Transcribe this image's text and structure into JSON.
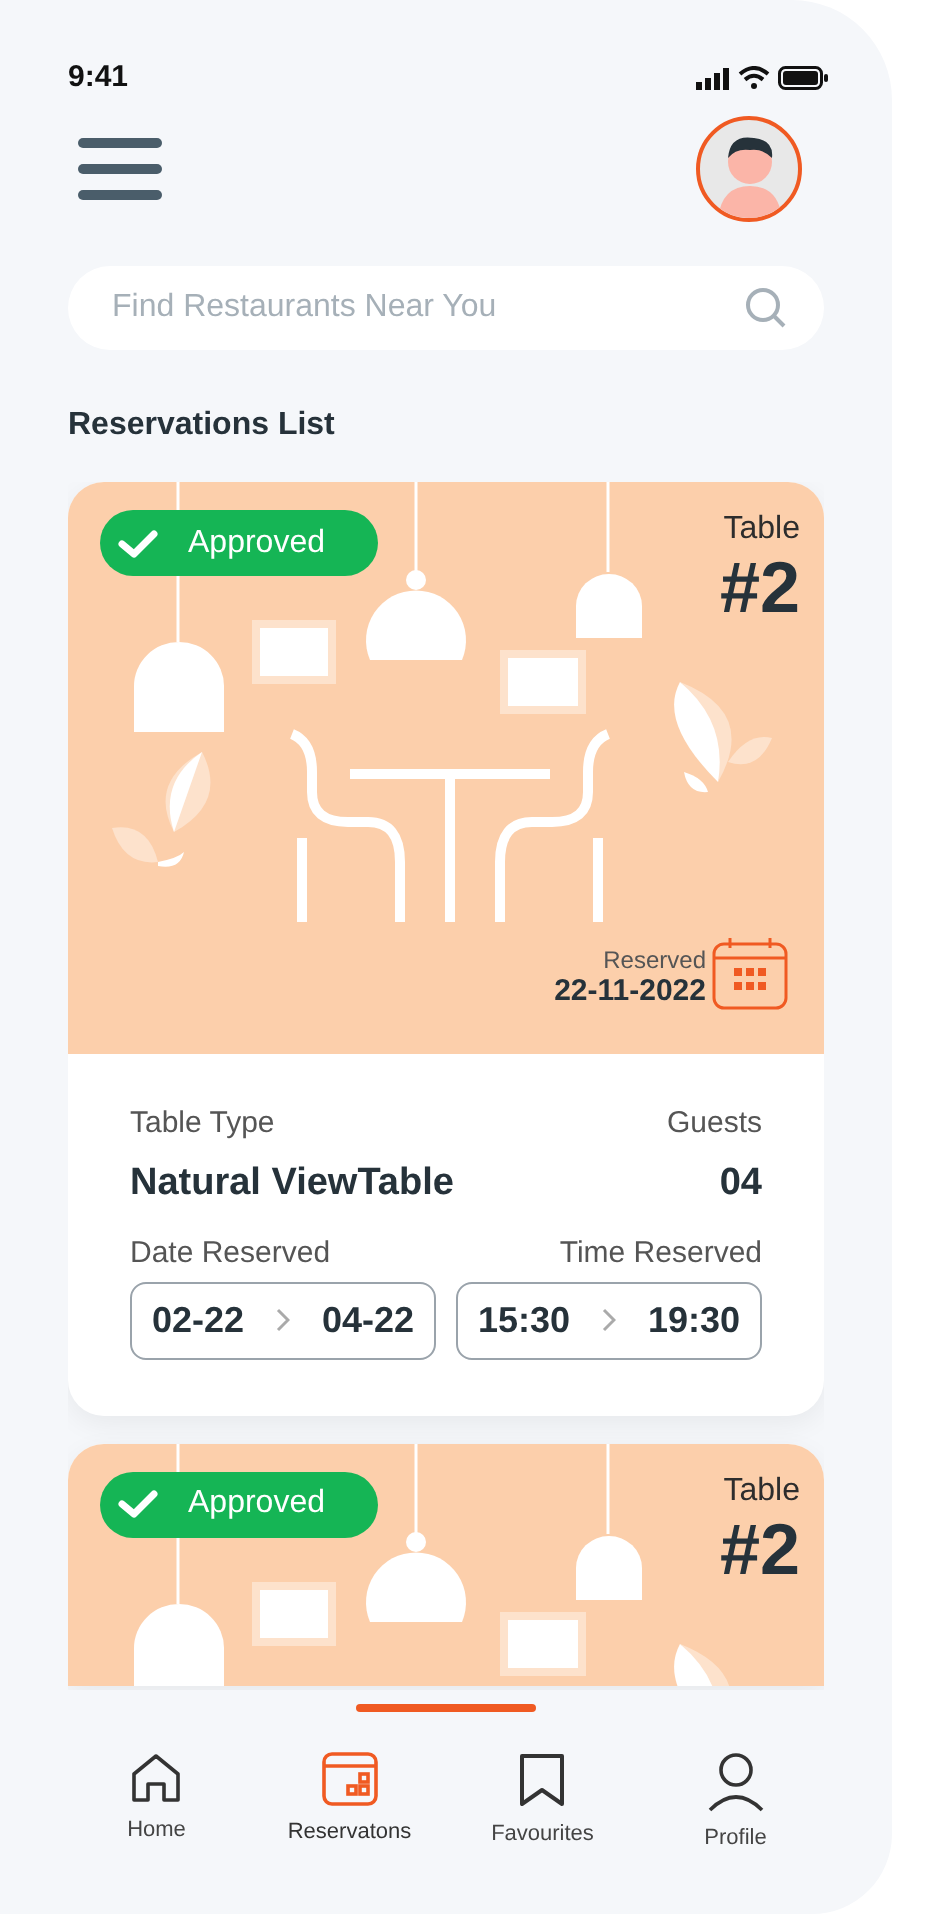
{
  "status_bar": {
    "time": "9:41"
  },
  "search": {
    "placeholder": "Find Restaurants Near You"
  },
  "section_title": "Reservations List",
  "reservations": [
    {
      "status": "Approved",
      "approved": true,
      "table_label": "Table",
      "table_number": "#2",
      "reserved_label": "Reserved",
      "reserved_date": "22-11-2022",
      "details": {
        "type_label": "Table Type",
        "type_value": "Natural ViewTable",
        "guests_label": "Guests",
        "guests_value": "04",
        "date_label": "Date Reserved",
        "date_from": "02-22",
        "date_to": "04-22",
        "time_label": "Time Reserved",
        "time_from": "15:30",
        "time_to": "19:30"
      }
    },
    {
      "status": "Approved",
      "approved": true,
      "table_label": "Table",
      "table_number": "#2"
    }
  ],
  "tab_bar": [
    {
      "label": "Home",
      "kind": "home",
      "selected": false
    },
    {
      "label": "Reservatons",
      "kind": "reservations",
      "selected": true
    },
    {
      "label": "Favourites",
      "kind": "favourites",
      "selected": false
    },
    {
      "label": "Profile",
      "kind": "profile",
      "selected": false
    }
  ]
}
